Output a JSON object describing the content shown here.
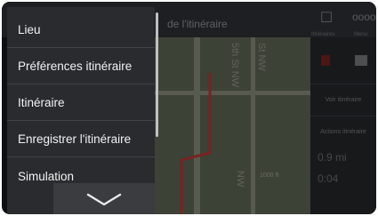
{
  "background": {
    "title": "de l'itinéraire",
    "top_icons": [
      {
        "name": "chat-icon",
        "label": "Itinéraires"
      },
      {
        "name": "more-icon",
        "label": "Menu"
      }
    ],
    "top_right_text": "oooo",
    "map": {
      "streets": [
        "5th St NW",
        "St NW",
        "NW"
      ],
      "scale": "1000 ft"
    },
    "side_buttons": [
      "Voir itinéraire",
      "Actions itinéraire"
    ],
    "stats": [
      "0.9 mi",
      "0:04"
    ]
  },
  "menu": {
    "items": [
      {
        "label": "Lieu"
      },
      {
        "label": "Préférences itinéraire"
      },
      {
        "label": "Itinéraire"
      },
      {
        "label": "Enregistrer l'itinéraire"
      },
      {
        "label": "Simulation"
      }
    ],
    "more_icon": "chevron-down-icon"
  }
}
